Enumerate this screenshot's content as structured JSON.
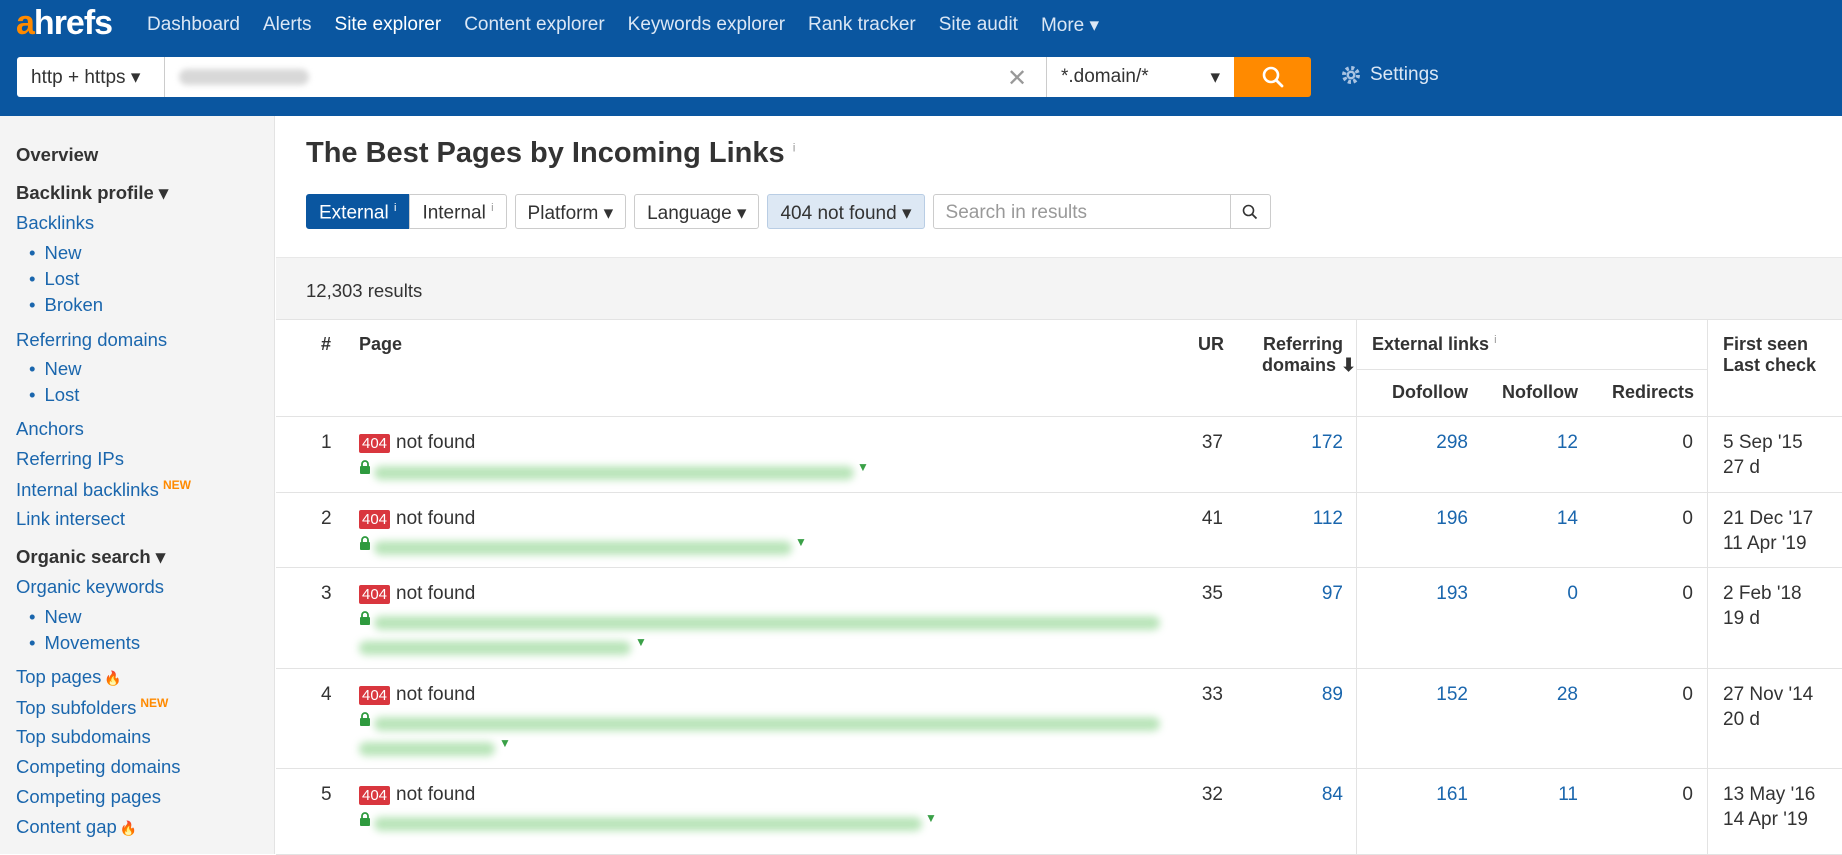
{
  "topbar": {
    "logo": "ahrefs",
    "nav": [
      "Dashboard",
      "Alerts",
      "Site explorer",
      "Content explorer",
      "Keywords explorer",
      "Rank tracker",
      "Site audit",
      "More ▾"
    ],
    "protocol": "http + https ▾",
    "mode": "*.domain/*",
    "settings": "Settings",
    "colors": {
      "bar": "#0a56a0",
      "accent": "#ff8a00"
    }
  },
  "sidebar": {
    "overview": "Overview",
    "backlink_profile": "Backlink profile ▾",
    "backlinks": "Backlinks",
    "backlinks_new": "New",
    "backlinks_lost": "Lost",
    "backlinks_broken": "Broken",
    "referring_domains": "Referring domains",
    "rd_new": "New",
    "rd_lost": "Lost",
    "anchors": "Anchors",
    "referring_ips": "Referring IPs",
    "internal_backlinks": "Internal backlinks",
    "new_tag": "NEW",
    "link_intersect": "Link intersect",
    "organic_search": "Organic search ▾",
    "organic_keywords": "Organic keywords",
    "ok_new": "New",
    "ok_movements": "Movements",
    "top_pages": "Top pages",
    "top_subfolders": "Top subfolders",
    "top_subdomains": "Top subdomains",
    "competing_domains": "Competing domains",
    "competing_pages": "Competing pages",
    "content_gap": "Content gap"
  },
  "main": {
    "title": "The Best Pages by Incoming Links",
    "info": "i",
    "filters": {
      "external": "External",
      "internal": "Internal",
      "platform": "Platform ▾",
      "language": "Language ▾",
      "status": "404 not found ▾",
      "search_placeholder": "Search in results"
    },
    "results_count": "12,303 results",
    "headers": {
      "num": "#",
      "page": "Page",
      "ur": "UR",
      "ref_domains_1": "Referring",
      "ref_domains_2": "domains ⬇",
      "external_links": "External links",
      "dofollow": "Dofollow",
      "nofollow": "Nofollow",
      "redirects": "Redirects",
      "first_seen": "First seen",
      "last_check": "Last check"
    },
    "rows": [
      {
        "num": "1",
        "badge": "404",
        "status": "not found",
        "ur": "37",
        "rd": "172",
        "dofollow": "298",
        "nofollow": "12",
        "redirects": "0",
        "first_seen": "5 Sep '15",
        "last_check": "27 d"
      },
      {
        "num": "2",
        "badge": "404",
        "status": "not found",
        "ur": "41",
        "rd": "112",
        "dofollow": "196",
        "nofollow": "14",
        "redirects": "0",
        "first_seen": "21 Dec '17",
        "last_check": "11 Apr '19"
      },
      {
        "num": "3",
        "badge": "404",
        "status": "not found",
        "ur": "35",
        "rd": "97",
        "dofollow": "193",
        "nofollow": "0",
        "redirects": "0",
        "first_seen": "2 Feb '18",
        "last_check": "19 d"
      },
      {
        "num": "4",
        "badge": "404",
        "status": "not found",
        "ur": "33",
        "rd": "89",
        "dofollow": "152",
        "nofollow": "28",
        "redirects": "0",
        "first_seen": "27 Nov '14",
        "last_check": "20 d"
      },
      {
        "num": "5",
        "badge": "404",
        "status": "not found",
        "ur": "32",
        "rd": "84",
        "dofollow": "161",
        "nofollow": "11",
        "redirects": "0",
        "first_seen": "13 May '16",
        "last_check": "14 Apr '19"
      }
    ]
  }
}
